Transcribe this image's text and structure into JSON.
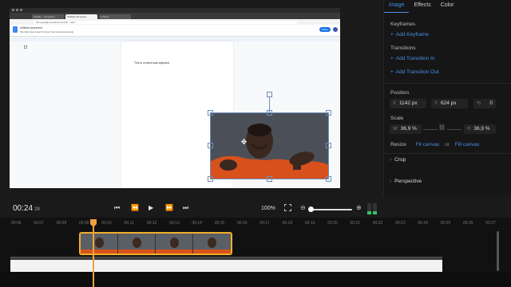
{
  "preview": {
    "browser_tabs": [
      "Fluidity – Integration",
      "Untitled document",
      "Untitled"
    ],
    "url": "docs.google.com/document/d/…/edit",
    "doc_title": "Untitled document",
    "doc_menu": "File  Edit  View  Insert  Format  Tools  Extensions  Help",
    "share_label": "Share",
    "doc_body_text": "This is content was adjusted"
  },
  "panel": {
    "tabs": [
      "Image",
      "Effects",
      "Color"
    ],
    "active_tab": "Image",
    "keyframes_title": "Keyframes",
    "add_keyframe": "Add Keyframe",
    "transitions_title": "Transitions",
    "add_transition_in": "Add Transition In",
    "add_transition_out": "Add Transition Out",
    "position_title": "Position",
    "pos_x_label": "X",
    "pos_x_value": "1142 px",
    "pos_y_label": "Y",
    "pos_y_value": "624 px",
    "rotation_value": "0",
    "scale_title": "Scale",
    "scale_w_label": "W",
    "scale_w_value": "36,9 %",
    "scale_h_label": "H",
    "scale_h_value": "36,9 %",
    "resize_title": "Resize",
    "fit_canvas": "Fit canvas",
    "resize_or": "or",
    "fill_canvas": "Fill canvas",
    "crop_label": "Crop",
    "perspective_label": "Perspective"
  },
  "transport": {
    "timecode": "00:24",
    "frames": "29",
    "zoom": "100%"
  },
  "timeline": {
    "ticks": [
      "00:06",
      "00:07",
      "00:08",
      "00:09",
      "00:10",
      "00:11",
      "00:12",
      "00:13",
      "00:14",
      "00:15",
      "00:16",
      "00:17",
      "00:18",
      "00:19",
      "00:20",
      "00:21",
      "00:22",
      "00:23",
      "00:24",
      "00:25",
      "00:26",
      "00:27"
    ]
  },
  "colors": {
    "accent": "#4a8fe7",
    "playhead": "#f0a23a",
    "clip_border": "#f0b02a"
  }
}
